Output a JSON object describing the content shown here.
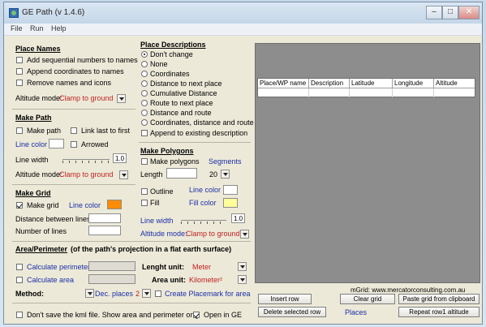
{
  "window": {
    "title": "GE Path (v 1.4.6)",
    "menu": [
      "File",
      "Run",
      "Help"
    ],
    "buttons": {
      "minimize": "–",
      "maximize": "□",
      "close": "✕"
    }
  },
  "place_names": {
    "title": "Place Names",
    "add_numbers": {
      "label": "Add sequential numbers to names",
      "checked": false
    },
    "append_coords": {
      "label": "Append coordinates to names",
      "checked": false
    },
    "remove_names": {
      "label": "Remove names and icons",
      "checked": false
    },
    "altitude_label": "Altitude mode:",
    "altitude_value": "Clamp to ground"
  },
  "make_path": {
    "title": "Make Path",
    "make_path": {
      "label": "Make path",
      "checked": false
    },
    "link_last": {
      "label": "Link last to first",
      "checked": false
    },
    "line_color_label": "Line color",
    "arrowed": {
      "label": "Arrowed",
      "checked": false
    },
    "line_width_label": "Line width",
    "line_width_value": "1.0",
    "altitude_label": "Altitude mode:",
    "altitude_value": "Clamp to ground",
    "line_color": "#ffffff"
  },
  "make_grid": {
    "title": "Make Grid",
    "make_grid": {
      "label": "Make grid",
      "checked": true
    },
    "line_color_label": "Line color",
    "line_color": "#ff8c00",
    "distance_label": "Distance between lines",
    "distance_value": "",
    "number_label": "Number of lines",
    "number_value": ""
  },
  "place_descriptions": {
    "title": "Place Descriptions",
    "options": [
      {
        "label": "Don't change",
        "checked": true
      },
      {
        "label": "None",
        "checked": false
      },
      {
        "label": "Coordinates",
        "checked": false
      },
      {
        "label": "Distance to next place",
        "checked": false
      },
      {
        "label": "Cumulative Distance",
        "checked": false
      },
      {
        "label": "Route to next place",
        "checked": false
      },
      {
        "label": "Distance and route",
        "checked": false
      },
      {
        "label": "Coordinates, distance and route",
        "checked": false
      }
    ],
    "append_existing": {
      "label": "Append to existing description",
      "checked": false
    }
  },
  "make_polygons": {
    "title": "Make Polygons",
    "make_polygons": {
      "label": "Make polygons",
      "checked": false
    },
    "segments_label": "Segments",
    "length_label": "Length",
    "length_value": "",
    "segments_value": "20",
    "outline": {
      "label": "Outline",
      "checked": false
    },
    "line_color_label": "Line color",
    "line_color": "#ffffff",
    "fill": {
      "label": "Fill",
      "checked": false
    },
    "fill_color_label": "Fill color",
    "fill_color": "#ffff99",
    "line_width_label": "Line width",
    "line_width_value": "1.0",
    "altitude_label": "Altitude mode:",
    "altitude_value": "Clamp to ground"
  },
  "area_perimeter": {
    "title": "Area/Perimeter",
    "subtitle": "(of the path's projection in a flat earth surface)",
    "calc_perimeter": {
      "label": "Calculate perimeter",
      "checked": false
    },
    "calc_area": {
      "label": "Calculate area",
      "checked": false
    },
    "length_unit_label": "Lenght unit:",
    "length_unit_value": "Meter",
    "area_unit_label": "Area unit:",
    "area_unit_value": "Kilometer²",
    "method_label": "Method:",
    "dec_places_label": "Dec. places",
    "dec_places_value": "2",
    "create_placemark": {
      "label": "Create Placemark for area",
      "checked": false
    }
  },
  "bottom": {
    "dont_save": {
      "label": "Don't save the kml file. Show area and perimeter only",
      "checked": false
    },
    "open_in_ge": {
      "label": "Open in GE",
      "checked": true
    }
  },
  "grid_panel": {
    "columns": [
      "Place/WP name",
      "Description",
      "Latitude",
      "Longitude",
      "Altitude"
    ],
    "credit": "mGrid: www.mercatorconsulting.com.au",
    "insert_row": "Insert row",
    "clear_grid": "Clear grid",
    "paste_grid": "Paste grid from clipboard",
    "delete_rows": "Delete selected row",
    "places_label": "Places",
    "repeat_altitude": "Repeat row1 altitude"
  }
}
